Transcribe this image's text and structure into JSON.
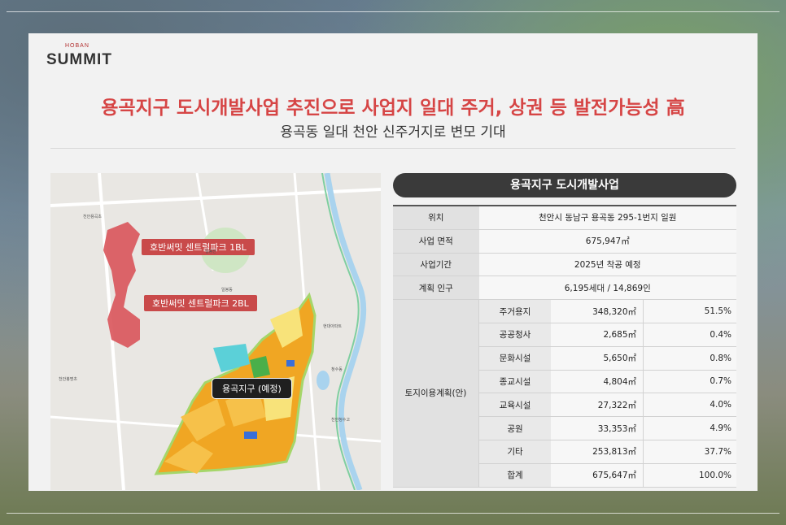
{
  "brand": {
    "small": "HOBAN",
    "name": "SUMMIT"
  },
  "headline": "용곡지구 도시개발사업 추진으로 사업지 일대 주거, 상권 등 발전가능성 高",
  "subline": "용곡동 일대 천안 신주거지로 변모 기대",
  "map": {
    "callout_1": "호반써밋 센트럴파크 1BL",
    "callout_2": "호반써밋 센트럴파크 2BL",
    "district_label": "용곡지구 (예정)",
    "place_labels": [
      "일봉산",
      "일봉동",
      "천안용곡초",
      "청수동",
      "천안봉명초",
      "현대아파트",
      "천안청수고"
    ]
  },
  "project": {
    "title": "용곡지구 도시개발사업",
    "rows": [
      {
        "key": "위치",
        "value": "천안시 동남구 용곡동 295-1번지 일원"
      },
      {
        "key": "사업 면적",
        "value": "675,947㎡"
      },
      {
        "key": "사업기간",
        "value": "2025년 착공 예정"
      },
      {
        "key": "계획 인구",
        "value": "6,195세대 / 14,869인"
      }
    ],
    "land_use": {
      "key": "토지이용계획(안)",
      "items": [
        {
          "name": "주거용지",
          "area": "348,320㎡",
          "pct": "51.5%"
        },
        {
          "name": "공공청사",
          "area": "2,685㎡",
          "pct": "0.4%"
        },
        {
          "name": "문화시설",
          "area": "5,650㎡",
          "pct": "0.8%"
        },
        {
          "name": "종교시설",
          "area": "4,804㎡",
          "pct": "0.7%"
        },
        {
          "name": "교육시설",
          "area": "27,322㎡",
          "pct": "4.0%"
        },
        {
          "name": "공원",
          "area": "33,353㎡",
          "pct": "4.9%"
        },
        {
          "name": "기타",
          "area": "253,813㎡",
          "pct": "37.7%"
        },
        {
          "name": "합계",
          "area": "675,647㎡",
          "pct": "100.0%"
        }
      ]
    }
  }
}
